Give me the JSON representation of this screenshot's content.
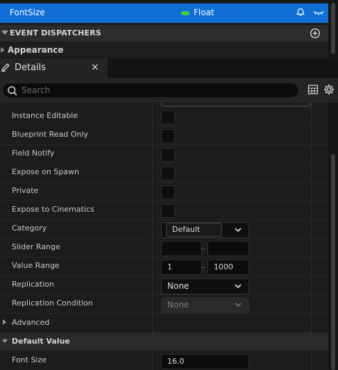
{
  "blueprint": {
    "variable": {
      "name": "FontSize",
      "type": "Float",
      "type_color": "#3fd03f",
      "bell_icon": "bell-icon",
      "eye_icon": "eye-icon"
    },
    "event_dispatchers": {
      "title": "EVENT DISPATCHERS",
      "add_icon": "add-circle-icon"
    },
    "appearance": {
      "label": "Appearance"
    }
  },
  "details": {
    "tab_label": "Details",
    "close_glyph": "×",
    "search_placeholder": "Search",
    "properties": {
      "instance_editable": "Instance Editable",
      "blueprint_read_only": "Blueprint Read Only",
      "field_notify": "Field Notify",
      "expose_on_spawn": "Expose on Spawn",
      "private": "Private",
      "expose_to_cinematics": "Expose to Cinematics",
      "category": {
        "label": "Category",
        "value": "Default"
      },
      "slider_range": {
        "label": "Slider Range",
        "min": "",
        "max": "",
        "sep": ".."
      },
      "value_range": {
        "label": "Value Range",
        "min": "1",
        "max": "1000",
        "sep": ".."
      },
      "replication": {
        "label": "Replication",
        "value": "None"
      },
      "replication_condition": {
        "label": "Replication Condition",
        "value": "None"
      }
    },
    "advanced": {
      "label": "Advanced"
    },
    "default_value": {
      "label": "Default Value",
      "font_size": {
        "label": "Font Size",
        "value": "16.0"
      }
    }
  },
  "colors": {
    "selection": "#0f6fd6",
    "panel": "#1c1c1c",
    "header": "#2a2a2a"
  }
}
